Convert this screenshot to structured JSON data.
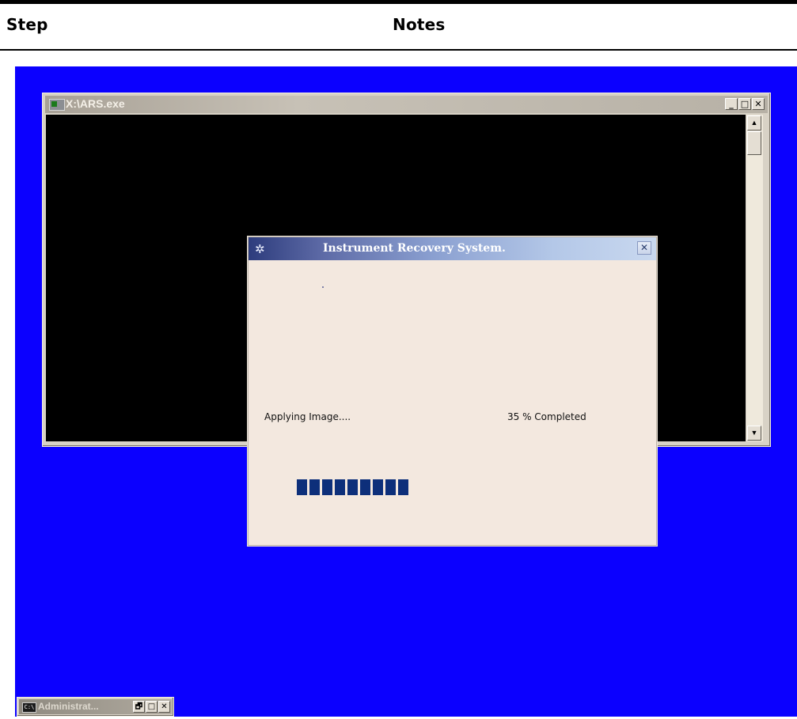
{
  "document": {
    "header_step": "Step",
    "header_notes": "Notes"
  },
  "console_window": {
    "title": "X:\\ARS.exe",
    "buttons": {
      "minimize": "_",
      "maximize": "□",
      "close": "✕"
    },
    "scrollbar": {
      "up": "▲",
      "down": "▼"
    }
  },
  "dialog": {
    "title": "Instrument Recovery System.",
    "close": "✕",
    "status_text": "Applying Image....",
    "percent_text": "35 % Completed",
    "progress": 0.35,
    "progress_color": "#0d2f7a"
  },
  "minimized_window": {
    "title": "Administrat...",
    "icon": "C:\\",
    "buttons": {
      "restore": "🗗",
      "maximize": "□",
      "close": "✕"
    }
  },
  "colors": {
    "desktop_background": "#0b00ff",
    "console_background": "#000000",
    "dialog_background": "#f3e8df"
  }
}
